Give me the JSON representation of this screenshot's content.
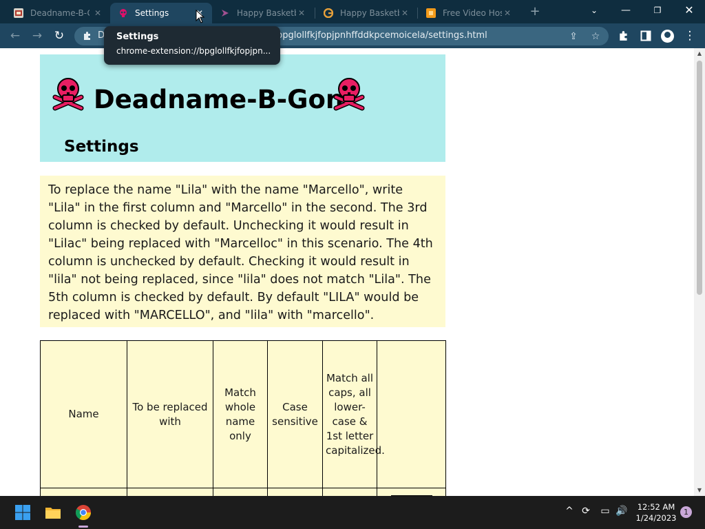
{
  "browser": {
    "tabs": [
      {
        "title": "Deadname-B-Gon",
        "icon": "deadname-b-gon-icon",
        "active": false
      },
      {
        "title": "Settings",
        "icon": "skull-icon",
        "active": true
      },
      {
        "title": "Happy Basketball",
        "icon": "happy-basket-icon",
        "active": false
      },
      {
        "title": "Happy Basketball",
        "icon": "google-icon",
        "active": false
      },
      {
        "title": "Free Video Hosting",
        "icon": "orange-site-icon",
        "active": false
      }
    ],
    "address_prefix": "D",
    "address_url": "bpglollfkjfopjpnhffddkpcemoicela/settings.html",
    "tooltip": {
      "title": "Settings",
      "url": "chrome-extension://bpglollfkjfopjpn..."
    }
  },
  "page": {
    "title": "Deadname-B-Gon",
    "subtitle": "Settings",
    "description": "To replace the name \"Lila\" with the name \"Marcello\", write \"Lila\" in the first column and \"Marcello\" in the second. The 3rd column is checked by default. Unchecking it would result in \"Lilac\" being replaced with \"Marcelloc\" in this scenario. The 4th column is unchecked by default. Checking it would result in \"lila\" not being replaced, since \"lila\" does not match \"Lila\". The 5th column is checked by default. By default \"LILA\" would be replaced with \"MARCELLO\", and \"lila\" with \"marcello\".",
    "table_headers": [
      "Name",
      "To be replaced with",
      "Match whole name only",
      "Case sensitive",
      "Match all caps, all lower-case & 1st letter capitalized.",
      ""
    ]
  },
  "taskbar": {
    "time": "12:52 AM",
    "date": "1/24/2023",
    "notification_count": "1"
  },
  "colors": {
    "header_bg": "#b0ecec",
    "panel_bg": "#fefad0",
    "titlebar": "#0f2d3f",
    "toolbar": "#1f4660"
  }
}
